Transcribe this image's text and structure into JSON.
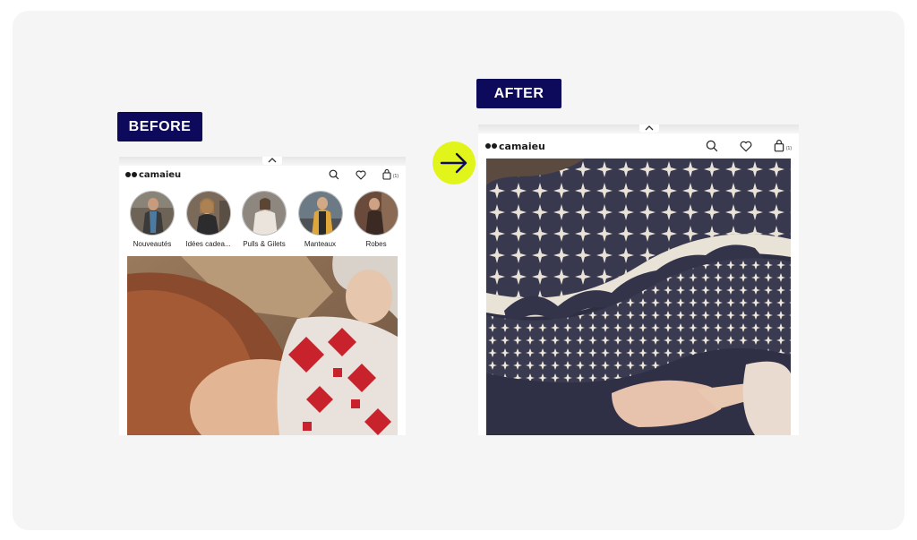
{
  "labels": {
    "before": "BEFORE",
    "after": "AFTER"
  },
  "brand": {
    "name": "camaieu",
    "accent": "#e2f51a",
    "badge_bg": "#0d0a5c"
  },
  "header": {
    "bag_count": "(1)"
  },
  "stories": [
    {
      "label": "Nouveautés"
    },
    {
      "label": "Idées cadea..."
    },
    {
      "label": "Pulls & Gilets"
    },
    {
      "label": "Manteaux"
    },
    {
      "label": "Robes"
    }
  ],
  "icons": {
    "arrow": "arrow-right-icon",
    "search": "search-icon",
    "wishlist": "heart-icon",
    "bag": "shopping-bag-icon",
    "collapse": "chevron-up-icon"
  }
}
